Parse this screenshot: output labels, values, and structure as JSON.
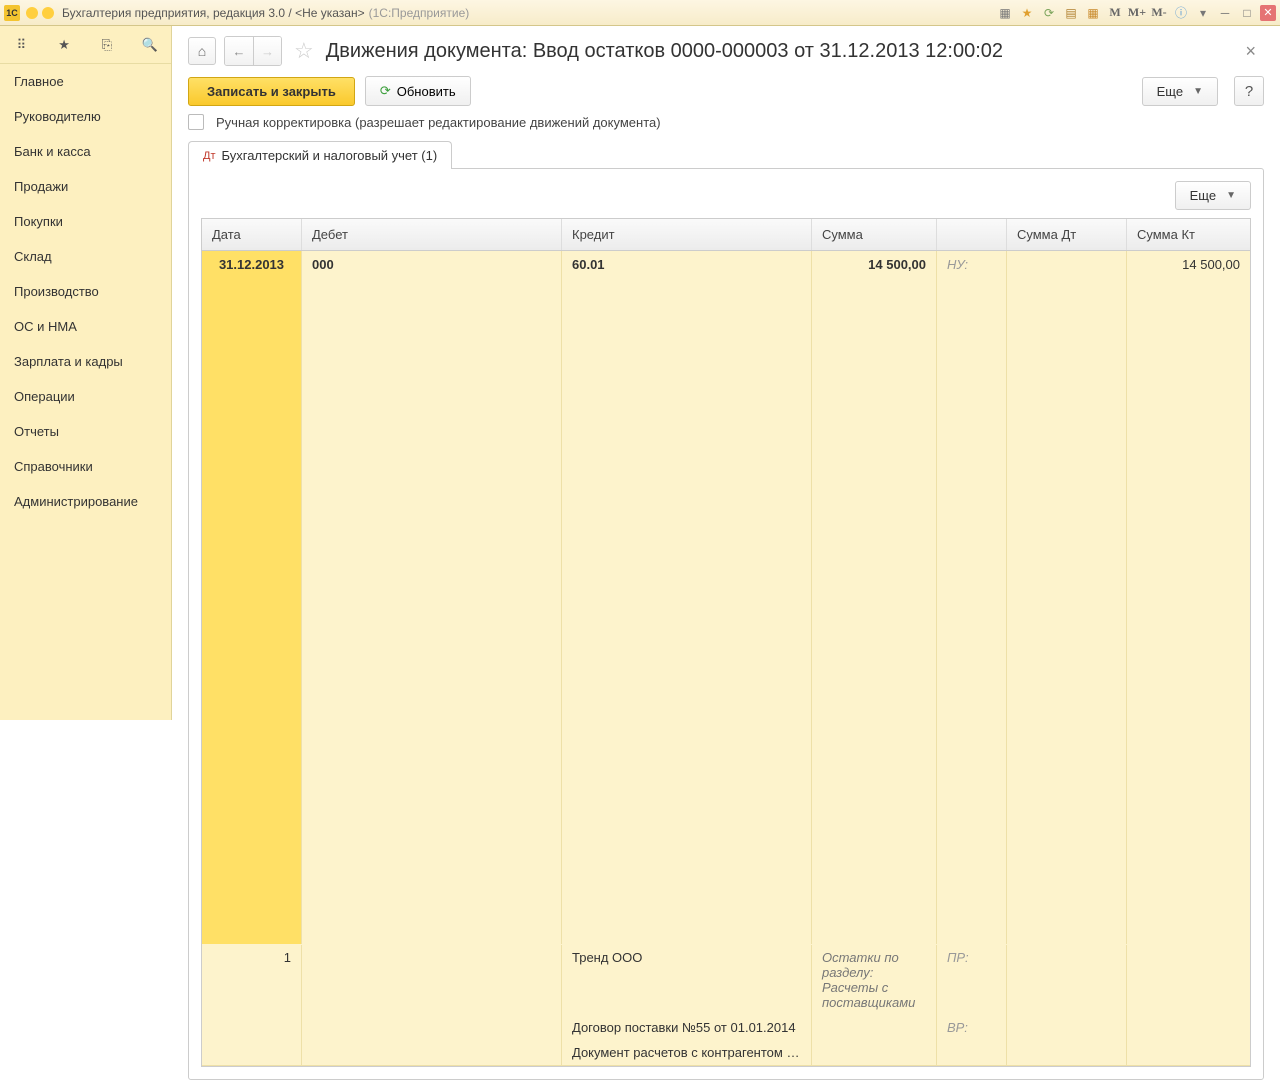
{
  "titlebar": {
    "app": "1С",
    "title": "Бухгалтерия предприятия, редакция 3.0 / <Не указан>",
    "suffix": "(1С:Предприятие)",
    "m": "М",
    "mplus": "М+",
    "mminus": "М-"
  },
  "sidebar": {
    "items": [
      "Главное",
      "Руководителю",
      "Банк и касса",
      "Продажи",
      "Покупки",
      "Склад",
      "Производство",
      "ОС и НМА",
      "Зарплата и кадры",
      "Операции",
      "Отчеты",
      "Справочники",
      "Администрирование"
    ]
  },
  "header": {
    "title": "Движения документа: Ввод остатков 0000-000003 от 31.12.2013 12:00:02"
  },
  "toolbar": {
    "save_close": "Записать и закрыть",
    "refresh": "Обновить",
    "more": "Еще",
    "help": "?"
  },
  "checkbox": {
    "label": "Ручная корректировка (разрешает редактирование движений документа)"
  },
  "tab": {
    "label": "Бухгалтерский и налоговый учет (1)"
  },
  "panel": {
    "more": "Еще"
  },
  "table": {
    "headers": {
      "date": "Дата",
      "debit": "Дебет",
      "credit": "Кредит",
      "sum": "Сумма",
      "sum_dt": "Сумма Дт",
      "sum_kt": "Сумма Кт"
    },
    "row": {
      "date": "31.12.2013",
      "n": "1",
      "debit": "000",
      "credit_acc": "60.01",
      "credit_l1": "Тренд ООО",
      "credit_l2": "Договор поставки №55 от 01.01.2014",
      "credit_l3": "Документ расчетов с контрагентом …",
      "sum": "14 500,00",
      "note": "Остатки по разделу: Расчеты с поставщиками",
      "ind1": "НУ:",
      "ind2": "ПР:",
      "ind3": "ВР:",
      "sum_kt": "14 500,00"
    }
  }
}
